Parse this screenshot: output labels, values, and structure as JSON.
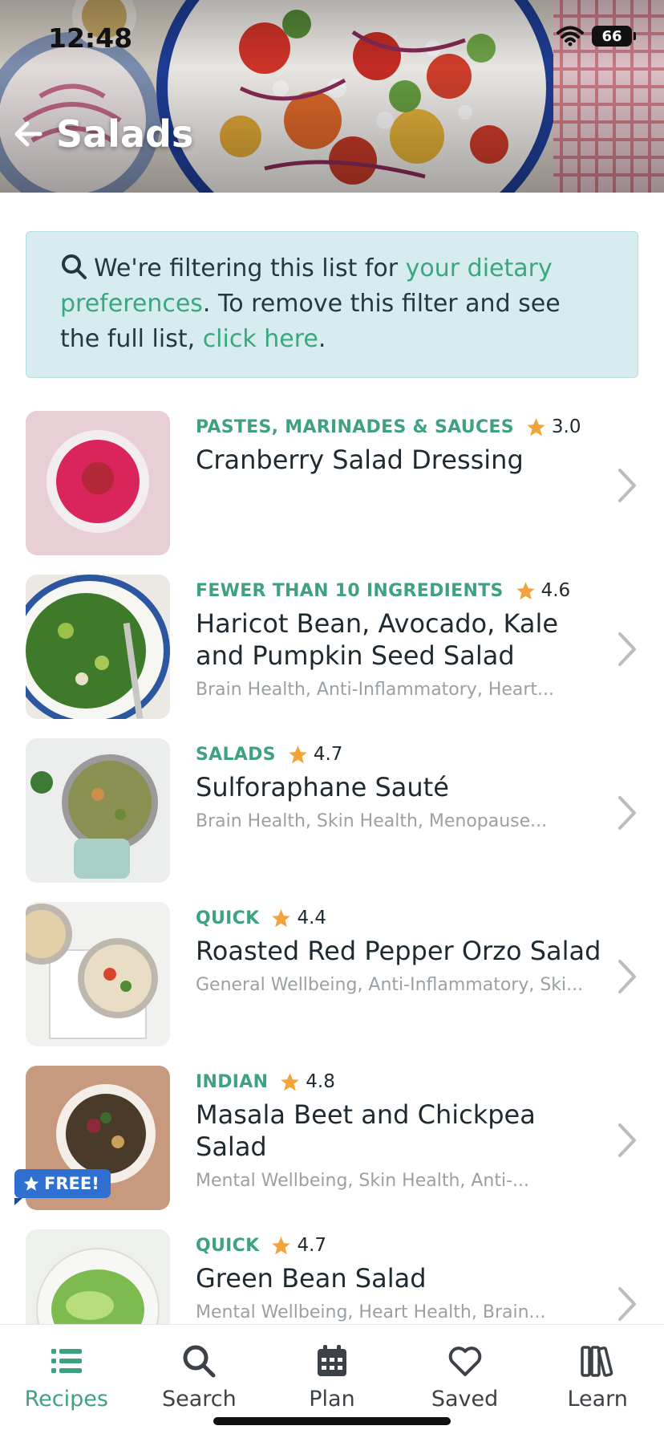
{
  "status_bar": {
    "time": "12:48",
    "battery": "66"
  },
  "header": {
    "title": "Salads"
  },
  "notice": {
    "prefix": "We're filtering this list for ",
    "link1": "your dietary preferences",
    "middle": ". To remove this filter and see the full list, ",
    "link2": "click here",
    "suffix": "."
  },
  "recipes": [
    {
      "category": "PASTES, MARINADES & SAUCES",
      "rating": "3.0",
      "title": "Cranberry Salad Dressing",
      "tags": ""
    },
    {
      "category": "FEWER THAN 10 INGREDIENTS",
      "rating": "4.6",
      "title": "Haricot Bean, Avocado, Kale and Pumpkin Seed Salad",
      "tags": "Brain Health, Anti-Inflammatory, Heart..."
    },
    {
      "category": "SALADS",
      "rating": "4.7",
      "title": "Sulforaphane Sauté",
      "tags": "Brain Health, Skin Health, Menopause..."
    },
    {
      "category": "QUICK",
      "rating": "4.4",
      "title": "Roasted Red Pepper Orzo Salad",
      "tags": "General Wellbeing, Anti-Inflammatory, Ski..."
    },
    {
      "category": "INDIAN",
      "rating": "4.8",
      "title": "Masala Beet and Chickpea Salad",
      "tags": "Mental Wellbeing, Skin Health, Anti-...",
      "badge": "FREE!"
    },
    {
      "category": "QUICK",
      "rating": "4.7",
      "title": "Green Bean Salad",
      "tags": "Mental Wellbeing, Heart Health, Brain..."
    }
  ],
  "tabbar": {
    "recipes": "Recipes",
    "search": "Search",
    "plan": "Plan",
    "saved": "Saved",
    "learn": "Learn"
  },
  "colors": {
    "accent": "#3fa27e",
    "star": "#f2a33a",
    "notice_bg": "#d7ecef",
    "badge": "#2f6fd1"
  },
  "icons": [
    "back-arrow-icon",
    "search-icon",
    "star-icon",
    "chevron-right-icon",
    "list-icon",
    "calendar-icon",
    "heart-icon",
    "books-icon",
    "wifi-icon",
    "battery-icon"
  ]
}
